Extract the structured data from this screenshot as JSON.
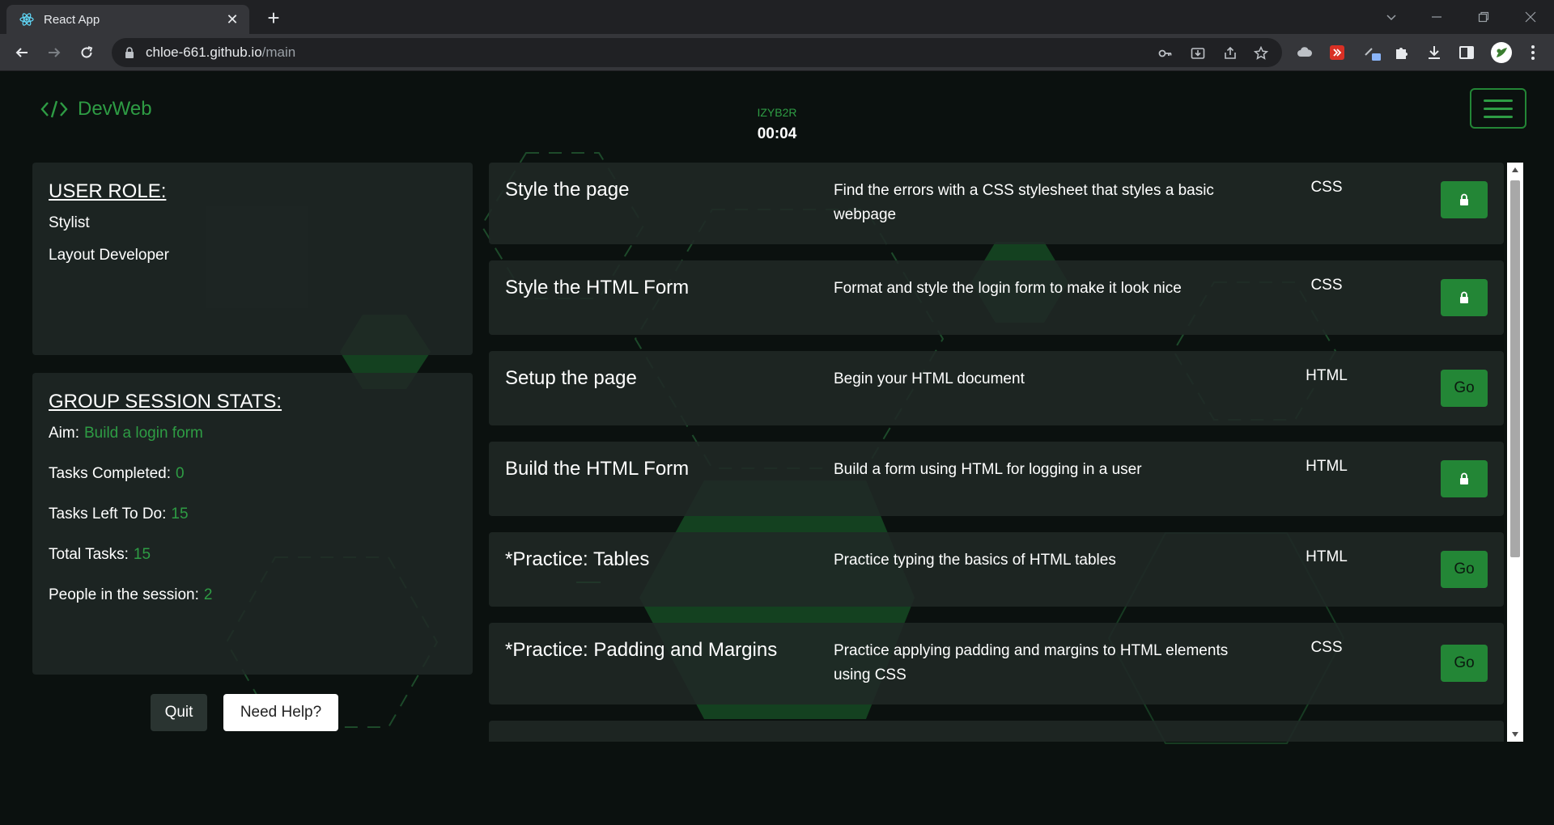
{
  "browser": {
    "tab_title": "React App",
    "url_host": "chloe-661.github.io",
    "url_path": "/main"
  },
  "header": {
    "brand": "DevWeb",
    "session_code": "IZYB2R",
    "timer": "00:04"
  },
  "user_role": {
    "title": "USER ROLE:",
    "roles": [
      "Stylist",
      "Layout Developer"
    ]
  },
  "stats": {
    "title": "GROUP SESSION STATS:",
    "items": [
      {
        "label": "Aim:",
        "value": "Build a login form"
      },
      {
        "label": "Tasks Completed:",
        "value": "0"
      },
      {
        "label": "Tasks Left To Do:",
        "value": "15"
      },
      {
        "label": "Total Tasks:",
        "value": "15"
      },
      {
        "label": "People in the session:",
        "value": "2"
      }
    ]
  },
  "buttons": {
    "quit": "Quit",
    "help": "Need Help?"
  },
  "tasks": [
    {
      "name": "Style the page",
      "desc": "Find the errors with a CSS stylesheet that styles a basic webpage",
      "lang": "CSS",
      "action": "locked",
      "action_label": ""
    },
    {
      "name": "Style the HTML Form",
      "desc": "Format and style the login form to make it look nice",
      "lang": "CSS",
      "action": "locked",
      "action_label": ""
    },
    {
      "name": "Setup the page",
      "desc": "Begin your HTML document",
      "lang": "HTML",
      "action": "go",
      "action_label": "Go"
    },
    {
      "name": "Build the HTML Form",
      "desc": "Build a form using HTML for logging in a user",
      "lang": "HTML",
      "action": "locked",
      "action_label": ""
    },
    {
      "name": "*Practice: Tables",
      "desc": "Practice typing the basics of HTML tables",
      "lang": "HTML",
      "action": "go",
      "action_label": "Go"
    },
    {
      "name": "*Practice: Padding and Margins",
      "desc": "Practice applying padding and margins to HTML elements using CSS",
      "lang": "CSS",
      "action": "go",
      "action_label": "Go"
    },
    {
      "name": "",
      "desc": "",
      "lang": "",
      "action": "none",
      "action_label": ""
    }
  ],
  "colors": {
    "accent": "#2e9c44",
    "button_green": "#238636",
    "page_bg": "#0b110f",
    "panel_bg": "#202826"
  }
}
